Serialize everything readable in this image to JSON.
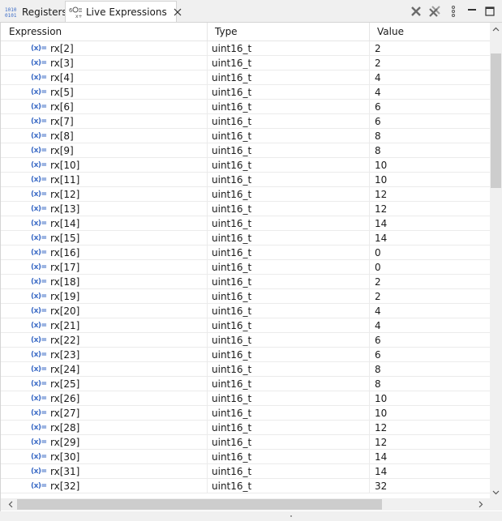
{
  "tabs": [
    {
      "label": "Registers",
      "icon": "registers-binary-icon"
    },
    {
      "label": "Live Expressions",
      "icon": "live-expressions-icon",
      "active": true
    }
  ],
  "toolbar": {
    "remove_label": "Remove Selected Expression",
    "remove_all_label": "Remove All Expressions",
    "view_menu_icon": "vertical-ellipsis-icon",
    "minimize_icon": "minimize-icon",
    "maximize_icon": "maximize-icon"
  },
  "table": {
    "columns": [
      "Expression",
      "Type",
      "Value"
    ],
    "rows": [
      {
        "expr": "rx[2]",
        "type": "uint16_t",
        "value": "2"
      },
      {
        "expr": "rx[3]",
        "type": "uint16_t",
        "value": "2"
      },
      {
        "expr": "rx[4]",
        "type": "uint16_t",
        "value": "4"
      },
      {
        "expr": "rx[5]",
        "type": "uint16_t",
        "value": "4"
      },
      {
        "expr": "rx[6]",
        "type": "uint16_t",
        "value": "6"
      },
      {
        "expr": "rx[7]",
        "type": "uint16_t",
        "value": "6"
      },
      {
        "expr": "rx[8]",
        "type": "uint16_t",
        "value": "8"
      },
      {
        "expr": "rx[9]",
        "type": "uint16_t",
        "value": "8"
      },
      {
        "expr": "rx[10]",
        "type": "uint16_t",
        "value": "10"
      },
      {
        "expr": "rx[11]",
        "type": "uint16_t",
        "value": "10"
      },
      {
        "expr": "rx[12]",
        "type": "uint16_t",
        "value": "12"
      },
      {
        "expr": "rx[13]",
        "type": "uint16_t",
        "value": "12"
      },
      {
        "expr": "rx[14]",
        "type": "uint16_t",
        "value": "14"
      },
      {
        "expr": "rx[15]",
        "type": "uint16_t",
        "value": "14"
      },
      {
        "expr": "rx[16]",
        "type": "uint16_t",
        "value": "0"
      },
      {
        "expr": "rx[17]",
        "type": "uint16_t",
        "value": "0"
      },
      {
        "expr": "rx[18]",
        "type": "uint16_t",
        "value": "2"
      },
      {
        "expr": "rx[19]",
        "type": "uint16_t",
        "value": "2"
      },
      {
        "expr": "rx[20]",
        "type": "uint16_t",
        "value": "4"
      },
      {
        "expr": "rx[21]",
        "type": "uint16_t",
        "value": "4"
      },
      {
        "expr": "rx[22]",
        "type": "uint16_t",
        "value": "6"
      },
      {
        "expr": "rx[23]",
        "type": "uint16_t",
        "value": "6"
      },
      {
        "expr": "rx[24]",
        "type": "uint16_t",
        "value": "8"
      },
      {
        "expr": "rx[25]",
        "type": "uint16_t",
        "value": "8"
      },
      {
        "expr": "rx[26]",
        "type": "uint16_t",
        "value": "10"
      },
      {
        "expr": "rx[27]",
        "type": "uint16_t",
        "value": "10"
      },
      {
        "expr": "rx[28]",
        "type": "uint16_t",
        "value": "12"
      },
      {
        "expr": "rx[29]",
        "type": "uint16_t",
        "value": "12"
      },
      {
        "expr": "rx[30]",
        "type": "uint16_t",
        "value": "14"
      },
      {
        "expr": "rx[31]",
        "type": "uint16_t",
        "value": "14"
      },
      {
        "expr": "rx[32]",
        "type": "uint16_t",
        "value": "32"
      }
    ]
  },
  "colors": {
    "expression_icon": "#3b6bc6",
    "scroll_thumb": "#cdcdcd",
    "background": "#ffffff"
  }
}
